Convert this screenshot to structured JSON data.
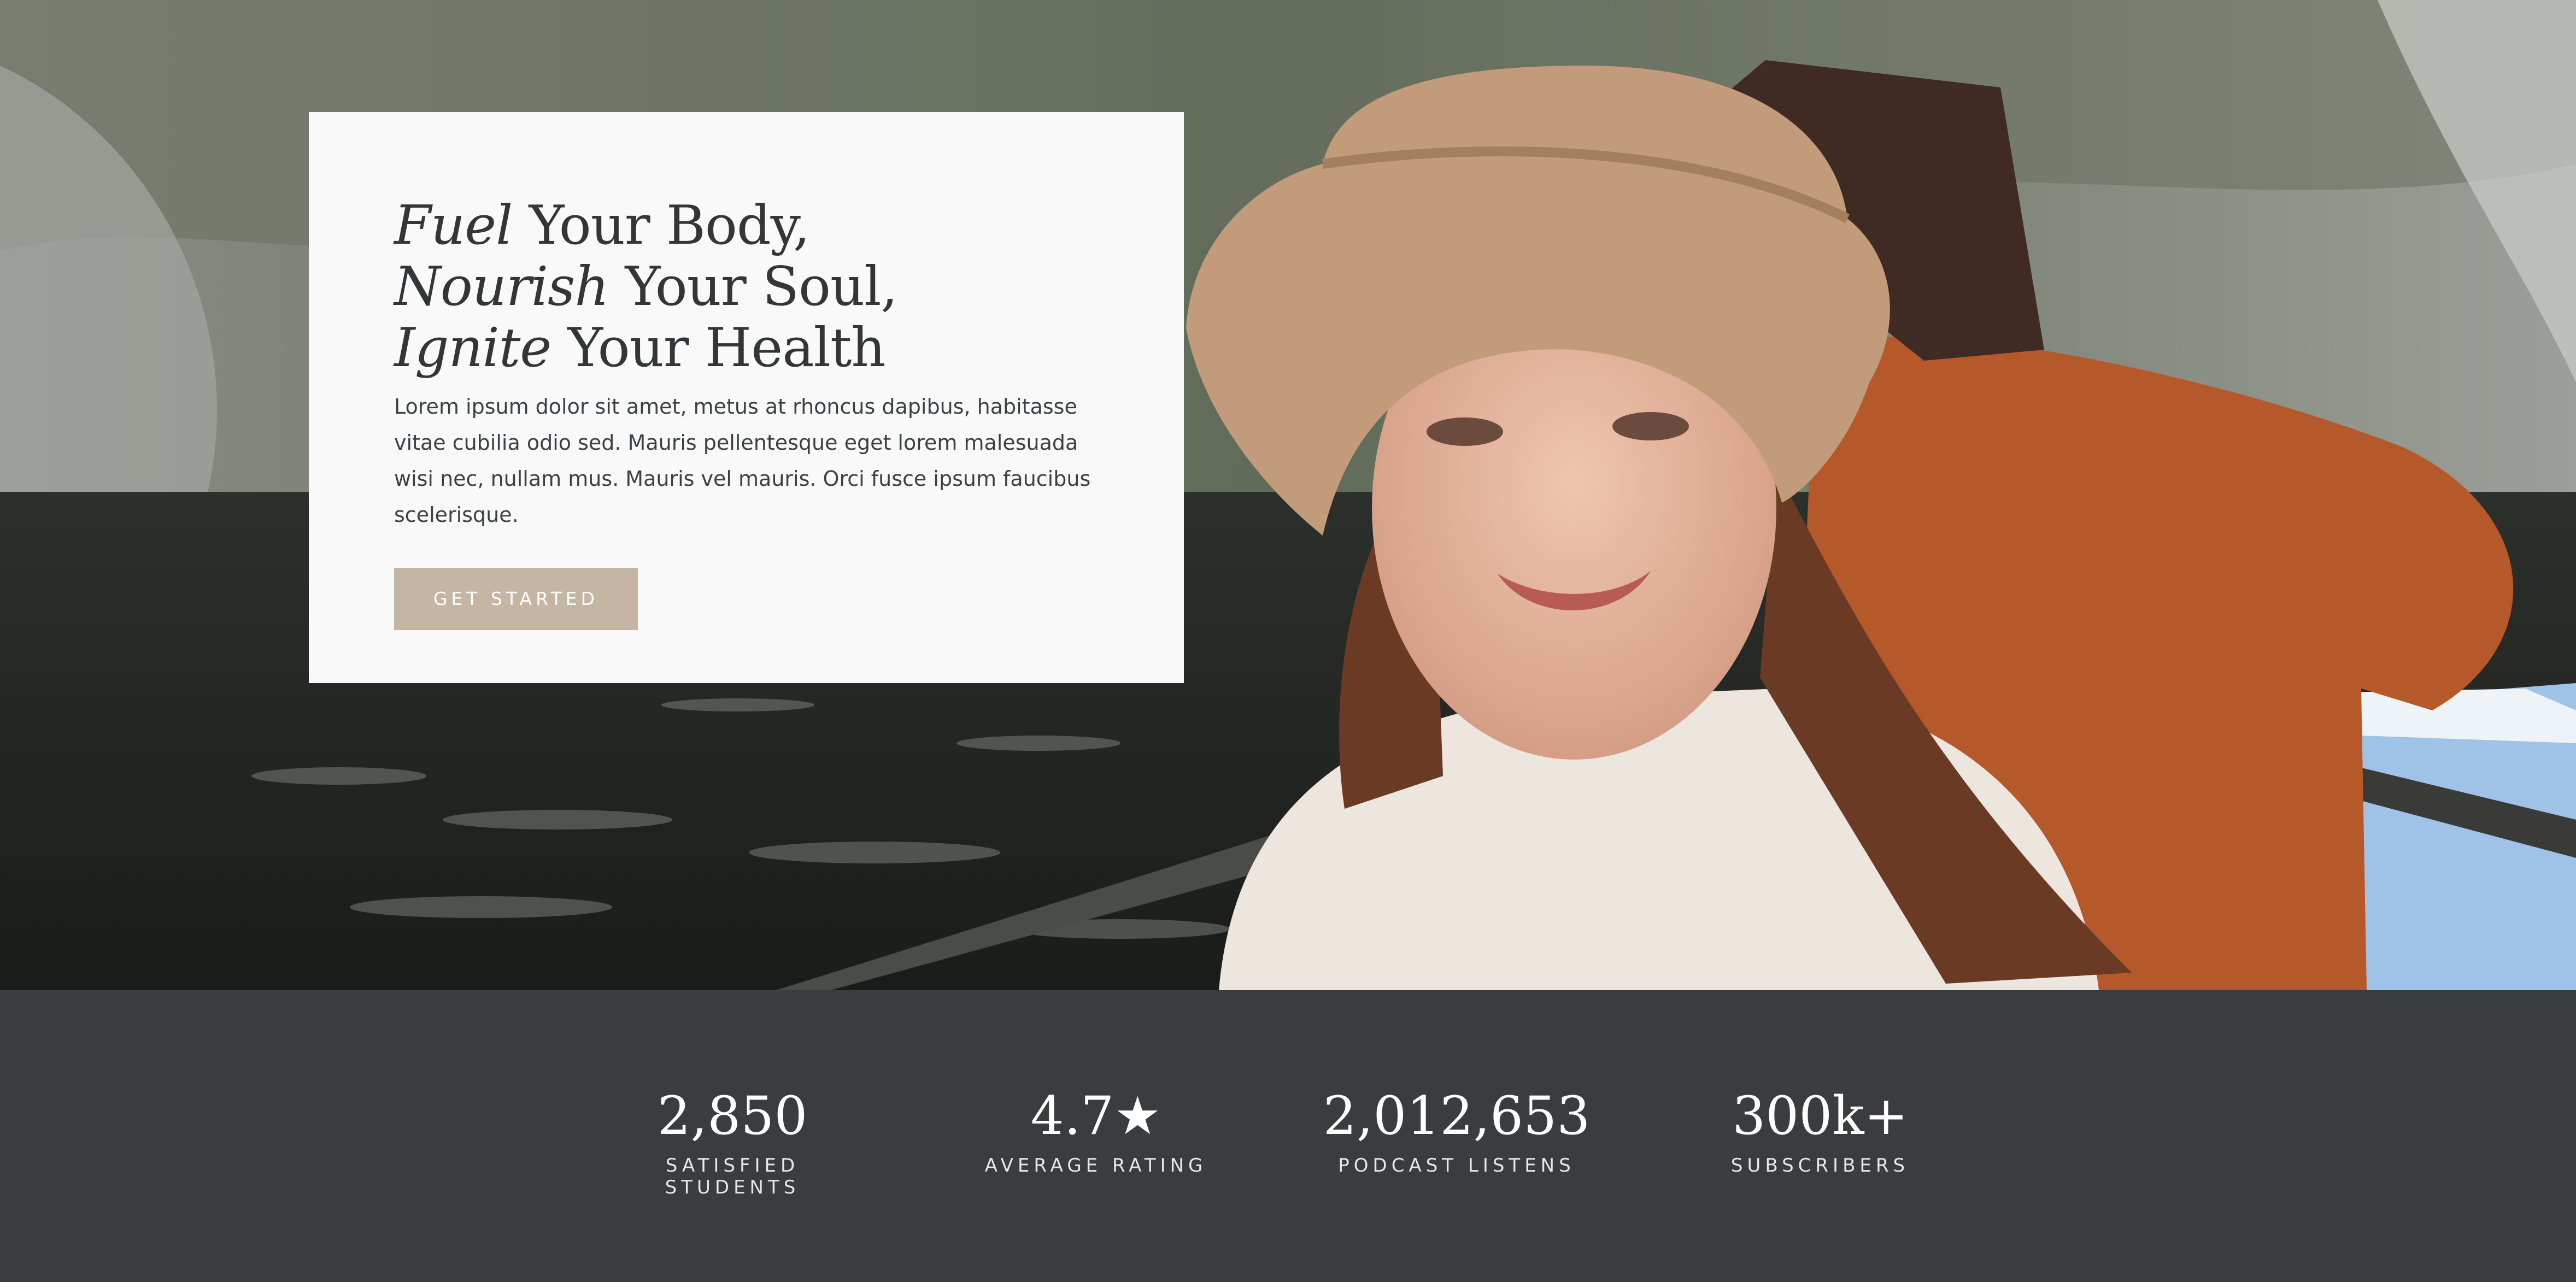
{
  "hero": {
    "headline": [
      {
        "italic": "Fuel",
        "rest": " Your Body,"
      },
      {
        "italic": "Nourish",
        "rest": " Your Soul,"
      },
      {
        "italic": "Ignite",
        "rest": " Your Health"
      }
    ],
    "body": "Lorem ipsum dolor sit amet, metus at rhoncus dapibus, habitasse vitae cubilia odio sed. Mauris pellentesque eget lorem malesuada wisi nec, nullam mus. Mauris vel mauris. Orci fusce ipsum faucibus scelerisque.",
    "cta_label": "GET STARTED"
  },
  "stats": [
    {
      "value": "2,850",
      "label": "SATISFIED STUDENTS"
    },
    {
      "value": "4.7★",
      "label": "AVERAGE RATING"
    },
    {
      "value": "2,012,653",
      "label": "PODCAST LISTENS"
    },
    {
      "value": "300k+",
      "label": "SUBSCRIBERS"
    }
  ],
  "colors": {
    "card_bg": "#f9f9f9",
    "cta_bg": "#c5b6a3",
    "stats_bg": "#3a3d40",
    "heading_text": "#333638"
  }
}
